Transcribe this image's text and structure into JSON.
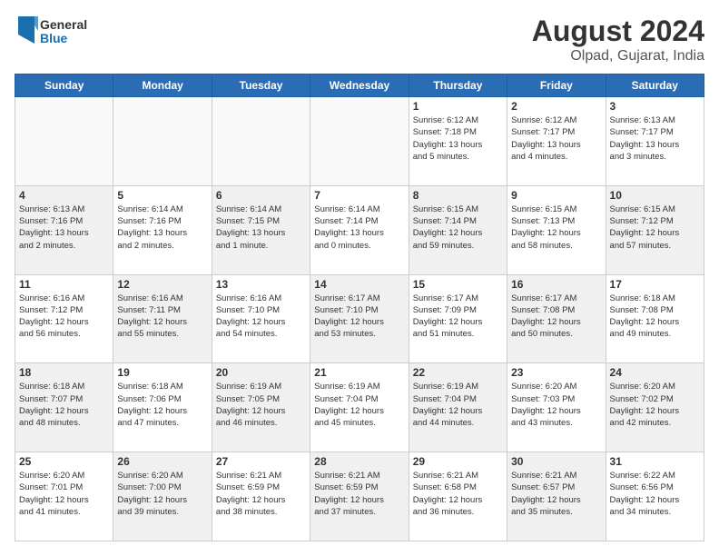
{
  "header": {
    "logo_general": "General",
    "logo_blue": "Blue",
    "month_year": "August 2024",
    "location": "Olpad, Gujarat, India"
  },
  "days_of_week": [
    "Sunday",
    "Monday",
    "Tuesday",
    "Wednesday",
    "Thursday",
    "Friday",
    "Saturday"
  ],
  "weeks": [
    [
      {
        "day": "",
        "empty": true
      },
      {
        "day": "",
        "empty": true
      },
      {
        "day": "",
        "empty": true
      },
      {
        "day": "",
        "empty": true
      },
      {
        "day": "1",
        "lines": [
          "Sunrise: 6:12 AM",
          "Sunset: 7:18 PM",
          "Daylight: 13 hours",
          "and 5 minutes."
        ]
      },
      {
        "day": "2",
        "lines": [
          "Sunrise: 6:12 AM",
          "Sunset: 7:17 PM",
          "Daylight: 13 hours",
          "and 4 minutes."
        ]
      },
      {
        "day": "3",
        "lines": [
          "Sunrise: 6:13 AM",
          "Sunset: 7:17 PM",
          "Daylight: 13 hours",
          "and 3 minutes."
        ]
      }
    ],
    [
      {
        "day": "4",
        "shaded": true,
        "lines": [
          "Sunrise: 6:13 AM",
          "Sunset: 7:16 PM",
          "Daylight: 13 hours",
          "and 2 minutes."
        ]
      },
      {
        "day": "5",
        "lines": [
          "Sunrise: 6:14 AM",
          "Sunset: 7:16 PM",
          "Daylight: 13 hours",
          "and 2 minutes."
        ]
      },
      {
        "day": "6",
        "shaded": true,
        "lines": [
          "Sunrise: 6:14 AM",
          "Sunset: 7:15 PM",
          "Daylight: 13 hours",
          "and 1 minute."
        ]
      },
      {
        "day": "7",
        "lines": [
          "Sunrise: 6:14 AM",
          "Sunset: 7:14 PM",
          "Daylight: 13 hours",
          "and 0 minutes."
        ]
      },
      {
        "day": "8",
        "shaded": true,
        "lines": [
          "Sunrise: 6:15 AM",
          "Sunset: 7:14 PM",
          "Daylight: 12 hours",
          "and 59 minutes."
        ]
      },
      {
        "day": "9",
        "lines": [
          "Sunrise: 6:15 AM",
          "Sunset: 7:13 PM",
          "Daylight: 12 hours",
          "and 58 minutes."
        ]
      },
      {
        "day": "10",
        "shaded": true,
        "lines": [
          "Sunrise: 6:15 AM",
          "Sunset: 7:12 PM",
          "Daylight: 12 hours",
          "and 57 minutes."
        ]
      }
    ],
    [
      {
        "day": "11",
        "lines": [
          "Sunrise: 6:16 AM",
          "Sunset: 7:12 PM",
          "Daylight: 12 hours",
          "and 56 minutes."
        ]
      },
      {
        "day": "12",
        "shaded": true,
        "lines": [
          "Sunrise: 6:16 AM",
          "Sunset: 7:11 PM",
          "Daylight: 12 hours",
          "and 55 minutes."
        ]
      },
      {
        "day": "13",
        "lines": [
          "Sunrise: 6:16 AM",
          "Sunset: 7:10 PM",
          "Daylight: 12 hours",
          "and 54 minutes."
        ]
      },
      {
        "day": "14",
        "shaded": true,
        "lines": [
          "Sunrise: 6:17 AM",
          "Sunset: 7:10 PM",
          "Daylight: 12 hours",
          "and 53 minutes."
        ]
      },
      {
        "day": "15",
        "lines": [
          "Sunrise: 6:17 AM",
          "Sunset: 7:09 PM",
          "Daylight: 12 hours",
          "and 51 minutes."
        ]
      },
      {
        "day": "16",
        "shaded": true,
        "lines": [
          "Sunrise: 6:17 AM",
          "Sunset: 7:08 PM",
          "Daylight: 12 hours",
          "and 50 minutes."
        ]
      },
      {
        "day": "17",
        "lines": [
          "Sunrise: 6:18 AM",
          "Sunset: 7:08 PM",
          "Daylight: 12 hours",
          "and 49 minutes."
        ]
      }
    ],
    [
      {
        "day": "18",
        "shaded": true,
        "lines": [
          "Sunrise: 6:18 AM",
          "Sunset: 7:07 PM",
          "Daylight: 12 hours",
          "and 48 minutes."
        ]
      },
      {
        "day": "19",
        "lines": [
          "Sunrise: 6:18 AM",
          "Sunset: 7:06 PM",
          "Daylight: 12 hours",
          "and 47 minutes."
        ]
      },
      {
        "day": "20",
        "shaded": true,
        "lines": [
          "Sunrise: 6:19 AM",
          "Sunset: 7:05 PM",
          "Daylight: 12 hours",
          "and 46 minutes."
        ]
      },
      {
        "day": "21",
        "lines": [
          "Sunrise: 6:19 AM",
          "Sunset: 7:04 PM",
          "Daylight: 12 hours",
          "and 45 minutes."
        ]
      },
      {
        "day": "22",
        "shaded": true,
        "lines": [
          "Sunrise: 6:19 AM",
          "Sunset: 7:04 PM",
          "Daylight: 12 hours",
          "and 44 minutes."
        ]
      },
      {
        "day": "23",
        "lines": [
          "Sunrise: 6:20 AM",
          "Sunset: 7:03 PM",
          "Daylight: 12 hours",
          "and 43 minutes."
        ]
      },
      {
        "day": "24",
        "shaded": true,
        "lines": [
          "Sunrise: 6:20 AM",
          "Sunset: 7:02 PM",
          "Daylight: 12 hours",
          "and 42 minutes."
        ]
      }
    ],
    [
      {
        "day": "25",
        "lines": [
          "Sunrise: 6:20 AM",
          "Sunset: 7:01 PM",
          "Daylight: 12 hours",
          "and 41 minutes."
        ]
      },
      {
        "day": "26",
        "shaded": true,
        "lines": [
          "Sunrise: 6:20 AM",
          "Sunset: 7:00 PM",
          "Daylight: 12 hours",
          "and 39 minutes."
        ]
      },
      {
        "day": "27",
        "lines": [
          "Sunrise: 6:21 AM",
          "Sunset: 6:59 PM",
          "Daylight: 12 hours",
          "and 38 minutes."
        ]
      },
      {
        "day": "28",
        "shaded": true,
        "lines": [
          "Sunrise: 6:21 AM",
          "Sunset: 6:59 PM",
          "Daylight: 12 hours",
          "and 37 minutes."
        ]
      },
      {
        "day": "29",
        "lines": [
          "Sunrise: 6:21 AM",
          "Sunset: 6:58 PM",
          "Daylight: 12 hours",
          "and 36 minutes."
        ]
      },
      {
        "day": "30",
        "shaded": true,
        "lines": [
          "Sunrise: 6:21 AM",
          "Sunset: 6:57 PM",
          "Daylight: 12 hours",
          "and 35 minutes."
        ]
      },
      {
        "day": "31",
        "lines": [
          "Sunrise: 6:22 AM",
          "Sunset: 6:56 PM",
          "Daylight: 12 hours",
          "and 34 minutes."
        ]
      }
    ]
  ]
}
